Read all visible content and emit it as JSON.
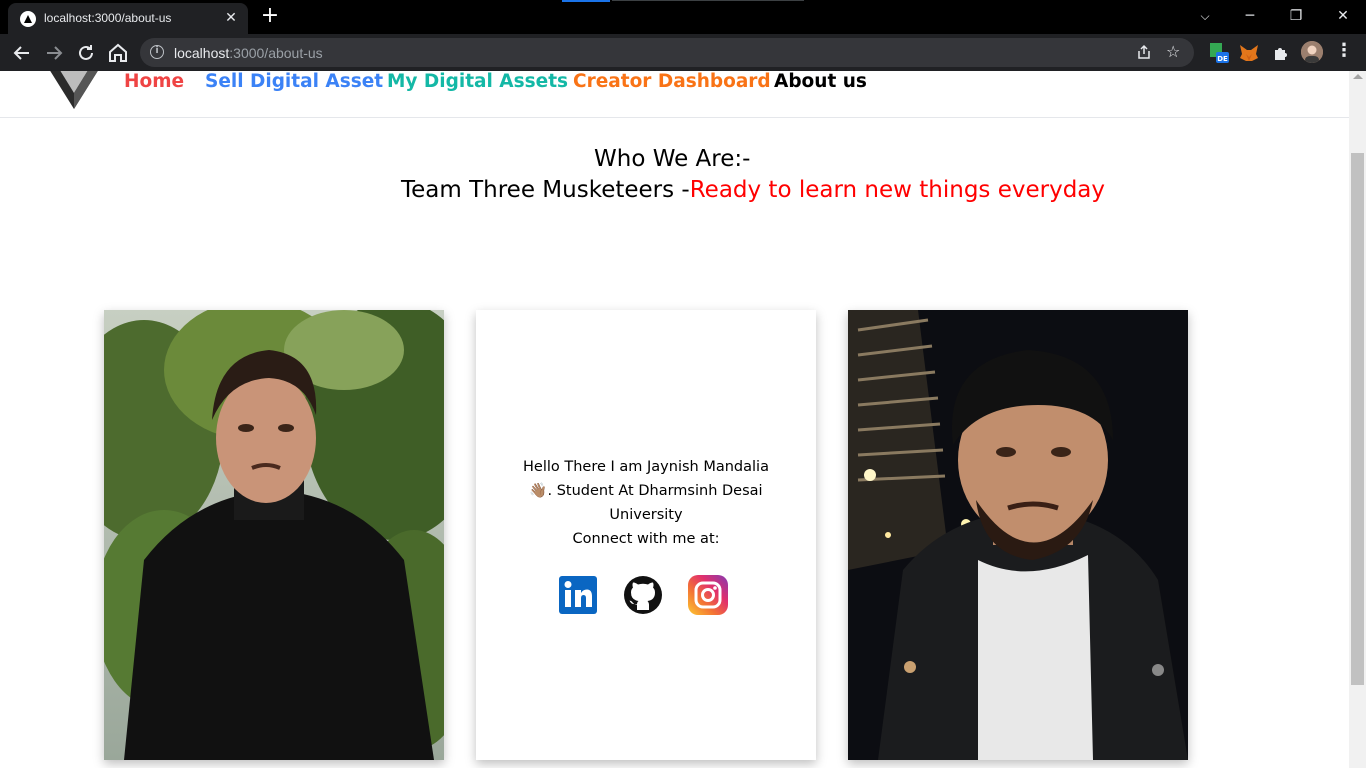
{
  "browser": {
    "tab_title": "localhost:3000/about-us",
    "tab_close": "✕",
    "new_tab": "+",
    "url_host": "localhost",
    "url_path": ":3000/about-us",
    "window_controls": {
      "minimize": "─",
      "restore": "❐",
      "close": "✕"
    },
    "extension_badge": "DE"
  },
  "navbar": {
    "links": [
      {
        "label": "Home",
        "color": "#ef4444"
      },
      {
        "label": "Sell Digital Asset",
        "color": "#3b82f6"
      },
      {
        "label": "My Digital Assets",
        "color": "#14b8a6"
      },
      {
        "label": "Creator Dashboard",
        "color": "#f97316"
      },
      {
        "label": "About us",
        "color": "#000000"
      }
    ]
  },
  "hero": {
    "heading": "Who We Are:-",
    "team_name": "Team Three Musketeers -",
    "tagline": "Ready to learn new things everyday",
    "tagline_color": "#ff0000"
  },
  "bio_card": {
    "line1": "Hello There I am Jaynish Mandalia",
    "emoji": "👋🏽",
    "line2": ". Student At Dharmsinh Desai University",
    "line3": "Connect with me at:",
    "socials": [
      "linkedin-icon",
      "github-icon",
      "instagram-icon"
    ]
  }
}
